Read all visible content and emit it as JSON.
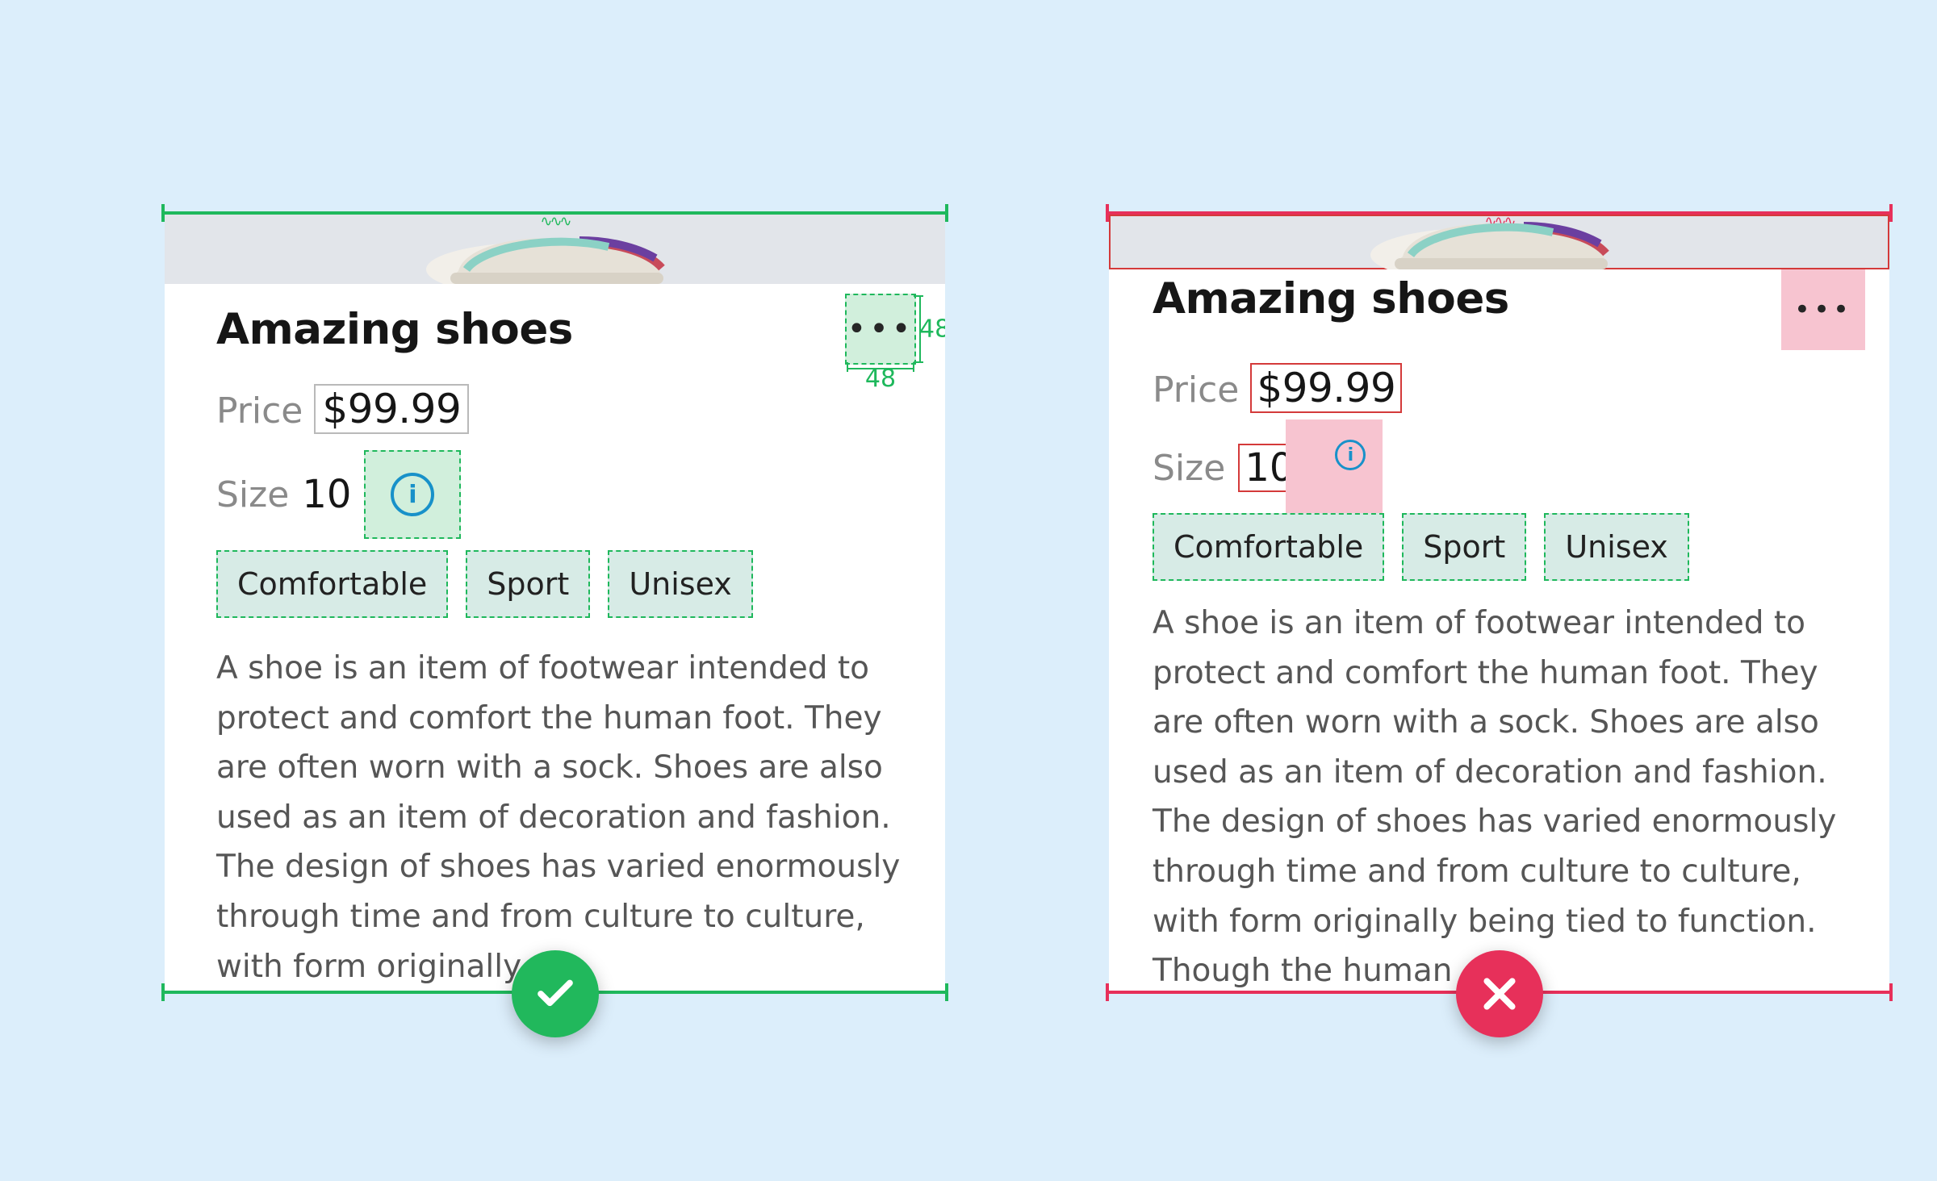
{
  "product": {
    "title": "Amazing shoes",
    "price_label": "Price",
    "price_value": "$99.99",
    "size_label": "Size",
    "size_value": "10",
    "tags": [
      "Comfortable",
      "Sport",
      "Unisex"
    ],
    "description_good": "A shoe is an item of footwear intended to protect and comfort the human foot. They are often worn with a sock. Shoes are also used as an item of decoration and fashion. The design of shoes has varied enormously through time and from culture to culture, with form originally",
    "description_bad": "A shoe is an item of footwear intended to protect and comfort the human foot. They are often worn with a sock. Shoes are also used as an item of decoration and fashion. The design of shoes has varied enormously through time and from culture to culture, with form originally being tied to function. Though the human"
  },
  "annotations": {
    "touch_size_px": "48",
    "good_color": "#1fb85c",
    "bad_color": "#e7305a"
  }
}
